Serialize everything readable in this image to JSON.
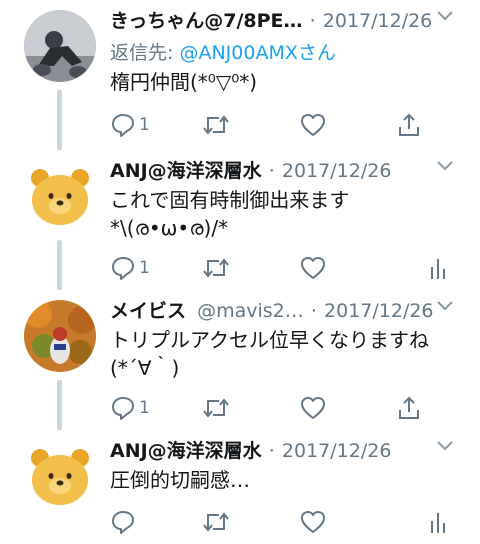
{
  "tweets": [
    {
      "name": "きっちゃん@7/8PE…",
      "handle": "",
      "date": "2017/12/26",
      "reply_prefix": "返信先: ",
      "reply_to": "@ANJ00AMXさん",
      "text": "楕円仲間(*⁰▽⁰*)",
      "reply_count": "1",
      "last_action": "share-icon",
      "avatar_colors": [
        "#8a8f96",
        "#3b3f45",
        "#d9d9d9"
      ]
    },
    {
      "name": "ANJ@海洋深層水",
      "handle": "",
      "date": "2017/12/26",
      "text": "これで固有時制御出来ます\n*\\(ര•ω•ര)/*",
      "reply_count": "1",
      "last_action": "analytics-icon",
      "avatar_colors": [
        "#f2c04a",
        "#e8a52a",
        "#ffffff"
      ]
    },
    {
      "name": "メイビス",
      "handle": "@mavis2…",
      "date": "2017/12/26",
      "text": "トリプルアクセル位早くなりますね\n(*´∀｀)",
      "reply_count": "1",
      "last_action": "share-icon",
      "avatar_colors": [
        "#d9731f",
        "#7a8a2a",
        "#c0392b"
      ]
    },
    {
      "name": "ANJ@海洋深層水",
      "handle": "",
      "date": "2017/12/26",
      "text": "圧倒的切嗣感…",
      "reply_count": "",
      "last_action": "analytics-icon",
      "avatar_colors": [
        "#f2c04a",
        "#e8a52a",
        "#ffffff"
      ]
    }
  ],
  "colors": {
    "icon": "#657786",
    "link": "#1da1f2",
    "thread": "#ccd6dd"
  }
}
